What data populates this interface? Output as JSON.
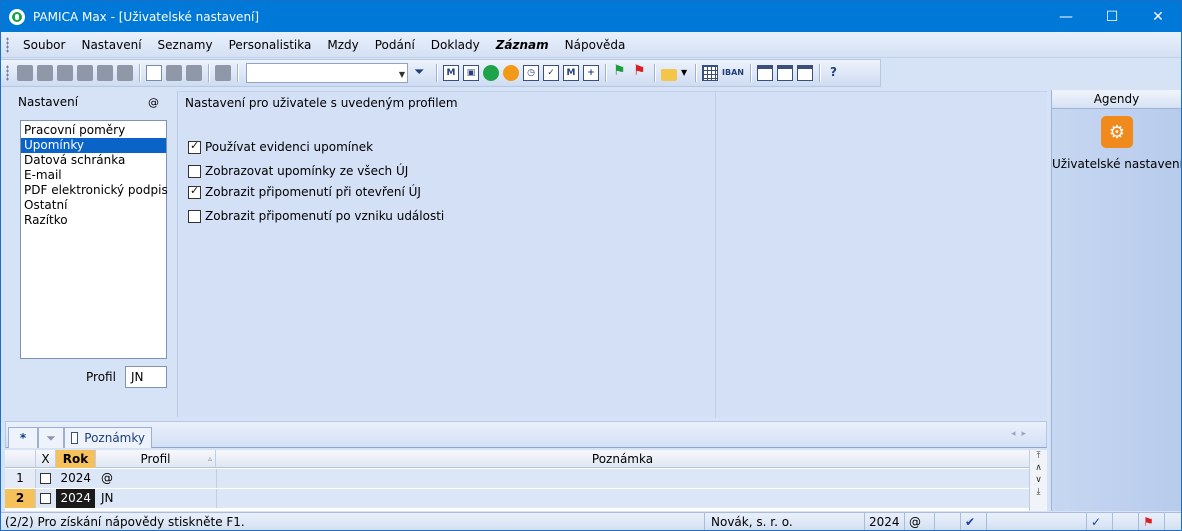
{
  "window": {
    "title": "PAMICA Max - [Uživatelské nastavení]",
    "minimize_glyph": "—",
    "maximize_glyph": "☐",
    "close_glyph": "✕"
  },
  "menu": {
    "items": [
      "Soubor",
      "Nastavení",
      "Seznamy",
      "Personalistika",
      "Mzdy",
      "Podání",
      "Doklady",
      "Záznam",
      "Nápověda"
    ]
  },
  "toolbar": {
    "combo_value": "",
    "iban_label": "IBAN"
  },
  "left_panel": {
    "title": "Nastavení",
    "at_symbol": "@",
    "items": [
      "Pracovní poměry",
      "Upomínky",
      "Datová schránka",
      "E-mail",
      "PDF elektronický podpis",
      "Ostatní",
      "Razítko"
    ],
    "selected_index": 1,
    "profile_label": "Profil",
    "profile_value": "JN"
  },
  "main_panel": {
    "title": "Nastavení pro uživatele s uvedeným profilem",
    "checkboxes": [
      {
        "label": "Používat evidenci upomínek",
        "checked": true
      },
      {
        "label": "Zobrazovat upomínky ze všech ÚJ",
        "checked": false
      },
      {
        "label": "Zobrazit připomenutí při otevření ÚJ",
        "checked": true
      },
      {
        "label": "Zobrazit připomenutí po vzniku události",
        "checked": false
      }
    ]
  },
  "agendy": {
    "header": "Agendy",
    "item_label": "Uživatelské nastavení",
    "icon": "user-settings-icon",
    "icon_color": "#f08a1d"
  },
  "bottom": {
    "tab_star": "*",
    "tab_notes": "Poznámky",
    "columns": {
      "x": "X",
      "rok": "Rok",
      "profil": "Profil",
      "poznamka": "Poznámka"
    },
    "rows": [
      {
        "num": "1",
        "rok": "2024",
        "profil": "@",
        "poznamka": ""
      },
      {
        "num": "2",
        "rok": "2024",
        "profil": "JN",
        "poznamka": ""
      }
    ]
  },
  "status": {
    "help": "(2/2) Pro získání nápovědy stiskněte F1.",
    "company": "Novák, s. r. o.",
    "year": "2024",
    "at": "@"
  },
  "colors": {
    "titlebar": "#0078d7",
    "selection": "#0a64c8",
    "active_header": "#f6c15a"
  }
}
